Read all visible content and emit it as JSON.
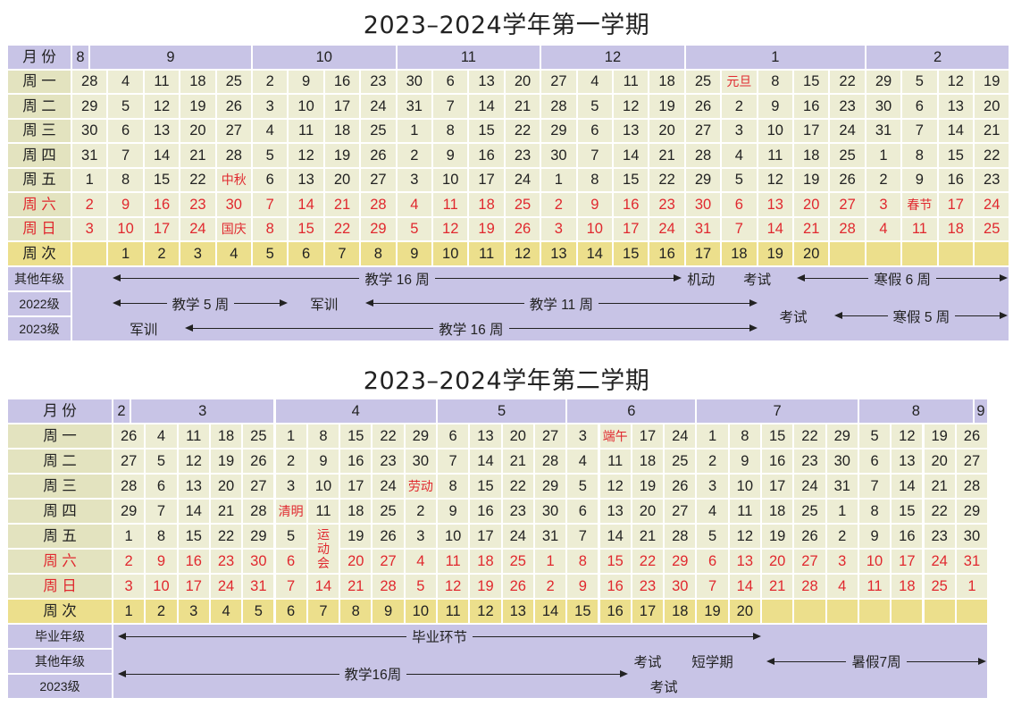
{
  "sem1": {
    "title": "2023–2024学年第一学期",
    "labels": {
      "month": "月 份",
      "weekno": "周 次"
    },
    "months": [
      "8",
      "9",
      "10",
      "11",
      "12",
      "1",
      "2"
    ],
    "rows": [
      {
        "label": "周 一",
        "red": false,
        "cells": [
          "28",
          "4",
          "11",
          "18",
          "25",
          "2",
          "9",
          "16",
          "23",
          "30",
          "6",
          "13",
          "20",
          "27",
          "4",
          "11",
          "18",
          "25",
          "元旦",
          "8",
          "15",
          "22",
          "29",
          "5",
          "12",
          "19"
        ]
      },
      {
        "label": "周 二",
        "red": false,
        "cells": [
          "29",
          "5",
          "12",
          "19",
          "26",
          "3",
          "10",
          "17",
          "24",
          "31",
          "7",
          "14",
          "21",
          "28",
          "5",
          "12",
          "19",
          "26",
          "2",
          "9",
          "16",
          "23",
          "30",
          "6",
          "13",
          "20"
        ]
      },
      {
        "label": "周 三",
        "red": false,
        "cells": [
          "30",
          "6",
          "13",
          "20",
          "27",
          "4",
          "11",
          "18",
          "25",
          "1",
          "8",
          "15",
          "22",
          "29",
          "6",
          "13",
          "20",
          "27",
          "3",
          "10",
          "17",
          "24",
          "31",
          "7",
          "14",
          "21"
        ]
      },
      {
        "label": "周 四",
        "red": false,
        "cells": [
          "31",
          "7",
          "14",
          "21",
          "28",
          "5",
          "12",
          "19",
          "26",
          "2",
          "9",
          "16",
          "23",
          "30",
          "7",
          "14",
          "21",
          "28",
          "4",
          "11",
          "18",
          "25",
          "1",
          "8",
          "15",
          "22"
        ]
      },
      {
        "label": "周 五",
        "red": false,
        "cells": [
          "1",
          "8",
          "15",
          "22",
          "中秋",
          "6",
          "13",
          "20",
          "27",
          "3",
          "10",
          "17",
          "24",
          "1",
          "8",
          "15",
          "22",
          "29",
          "5",
          "12",
          "19",
          "26",
          "2",
          "9",
          "16",
          "23"
        ]
      },
      {
        "label": "周 六",
        "red": true,
        "cells": [
          "2",
          "9",
          "16",
          "23",
          "30",
          "7",
          "14",
          "21",
          "28",
          "4",
          "11",
          "18",
          "25",
          "2",
          "9",
          "16",
          "23",
          "30",
          "6",
          "13",
          "20",
          "27",
          "3",
          "春节",
          "17",
          "24"
        ]
      },
      {
        "label": "周 日",
        "red": true,
        "cells": [
          "3",
          "10",
          "17",
          "24",
          "国庆",
          "8",
          "15",
          "22",
          "29",
          "5",
          "12",
          "19",
          "26",
          "3",
          "10",
          "17",
          "24",
          "31",
          "7",
          "14",
          "21",
          "28",
          "4",
          "11",
          "18",
          "25"
        ]
      }
    ],
    "weeks": [
      "",
      "1",
      "2",
      "3",
      "4",
      "5",
      "6",
      "7",
      "8",
      "9",
      "10",
      "11",
      "12",
      "13",
      "14",
      "15",
      "16",
      "17",
      "18",
      "19",
      "20",
      "",
      "",
      "",
      "",
      ""
    ],
    "plan": {
      "other_label": "其他年级",
      "other_teach": "教学 16 周",
      "other_flex": "机动",
      "other_exam": "考试",
      "other_break": "寒假 6 周",
      "g2022_label": "2022级",
      "g2022_teach1": "教学 5 周",
      "g2022_mil": "军训",
      "g2022_teach2": "教学 11 周",
      "g2023_label": "2023级",
      "g2023_mil": "军训",
      "g2023_teach": "教学 16 周",
      "exam": "考试",
      "break": "寒假 5 周"
    }
  },
  "sem2": {
    "title": "2023–2024学年第二学期",
    "labels": {
      "month": "月 份",
      "weekno": "周 次"
    },
    "months": [
      "2",
      "3",
      "4",
      "5",
      "6",
      "7",
      "8",
      "9"
    ],
    "rows": [
      {
        "label": "周 一",
        "red": false,
        "cells": [
          "26",
          "4",
          "11",
          "18",
          "25",
          "1",
          "8",
          "15",
          "22",
          "29",
          "6",
          "13",
          "20",
          "27",
          "3",
          "端午",
          "17",
          "24",
          "1",
          "8",
          "15",
          "22",
          "29",
          "5",
          "12",
          "19",
          "26"
        ]
      },
      {
        "label": "周 二",
        "red": false,
        "cells": [
          "27",
          "5",
          "12",
          "19",
          "26",
          "2",
          "9",
          "16",
          "23",
          "30",
          "7",
          "14",
          "21",
          "28",
          "4",
          "11",
          "18",
          "25",
          "2",
          "9",
          "16",
          "23",
          "30",
          "6",
          "13",
          "20",
          "27"
        ]
      },
      {
        "label": "周 三",
        "red": false,
        "cells": [
          "28",
          "6",
          "13",
          "20",
          "27",
          "3",
          "10",
          "17",
          "24",
          "劳动",
          "8",
          "15",
          "22",
          "29",
          "5",
          "12",
          "19",
          "26",
          "3",
          "10",
          "17",
          "24",
          "31",
          "7",
          "14",
          "21",
          "28"
        ]
      },
      {
        "label": "周 四",
        "red": false,
        "cells": [
          "29",
          "7",
          "14",
          "21",
          "28",
          "清明",
          "11",
          "18",
          "25",
          "2",
          "9",
          "16",
          "23",
          "30",
          "6",
          "13",
          "20",
          "27",
          "4",
          "11",
          "18",
          "25",
          "1",
          "8",
          "15",
          "22",
          "29"
        ]
      },
      {
        "label": "周 五",
        "red": false,
        "cells": [
          "1",
          "8",
          "15",
          "22",
          "29",
          "5",
          "运动会",
          "19",
          "26",
          "3",
          "10",
          "17",
          "24",
          "31",
          "7",
          "14",
          "21",
          "28",
          "5",
          "12",
          "19",
          "26",
          "2",
          "9",
          "16",
          "23",
          "30"
        ]
      },
      {
        "label": "周 六",
        "red": true,
        "cells": [
          "2",
          "9",
          "16",
          "23",
          "30",
          "6",
          "",
          "20",
          "27",
          "4",
          "11",
          "18",
          "25",
          "1",
          "8",
          "15",
          "22",
          "29",
          "6",
          "13",
          "20",
          "27",
          "3",
          "10",
          "17",
          "24",
          "31"
        ]
      },
      {
        "label": "周 日",
        "red": true,
        "cells": [
          "3",
          "10",
          "17",
          "24",
          "31",
          "7",
          "14",
          "21",
          "28",
          "5",
          "12",
          "19",
          "26",
          "2",
          "9",
          "16",
          "23",
          "30",
          "7",
          "14",
          "21",
          "28",
          "4",
          "11",
          "18",
          "25",
          "1"
        ]
      }
    ],
    "weeks": [
      "1",
      "2",
      "3",
      "4",
      "5",
      "6",
      "7",
      "8",
      "9",
      "10",
      "11",
      "12",
      "13",
      "14",
      "15",
      "16",
      "17",
      "18",
      "19",
      "20",
      "",
      "",
      "",
      "",
      "",
      "",
      ""
    ],
    "plan": {
      "grad_label": "毕业年级",
      "grad_text": "毕业环节",
      "other_label": "其他年级",
      "other_teach": "教学16周",
      "other_exam": "考试",
      "other_short": "短学期",
      "summer": "暑假7周",
      "g2023_label": "2023级",
      "g2023_exam": "考试"
    }
  }
}
